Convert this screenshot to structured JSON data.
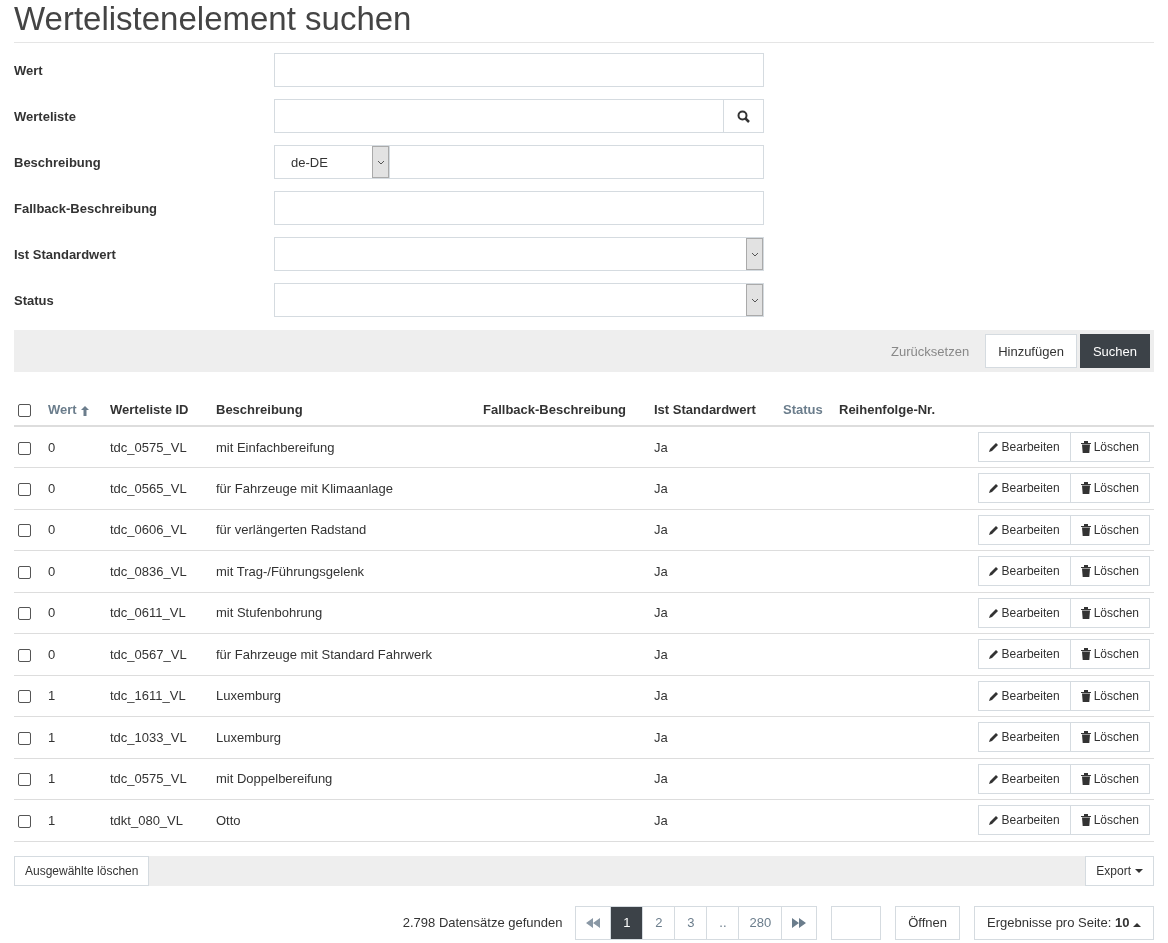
{
  "title": "Wertelistenelement suchen",
  "form": [
    {
      "label": "Wert",
      "kind": "text"
    },
    {
      "label": "Werteliste",
      "kind": "lookup"
    },
    {
      "label": "Beschreibung",
      "kind": "localized",
      "value": "de-DE"
    },
    {
      "label": "Fallback-Beschreibung",
      "kind": "text"
    },
    {
      "label": "Ist Standardwert",
      "kind": "select"
    },
    {
      "label": "Status",
      "kind": "select"
    }
  ],
  "form_actions": [
    {
      "label": "Zurücksetzen",
      "kind": "link"
    },
    {
      "label": "Hinzufügen",
      "kind": "default"
    },
    {
      "label": "Suchen",
      "kind": "primary"
    }
  ],
  "table": {
    "select_all": {
      "checked": false
    },
    "columns": [
      {
        "label": "Wert",
        "sortable": true,
        "sorted": true
      },
      {
        "label": "Werteliste ID",
        "sortable": false,
        "sorted": false
      },
      {
        "label": "Beschreibung",
        "sortable": false,
        "sorted": false
      },
      {
        "label": "Fallback-Beschreibung",
        "sortable": false,
        "sorted": false
      },
      {
        "label": "Ist Standardwert",
        "sortable": false,
        "sorted": false
      },
      {
        "label": "Status",
        "sortable": true,
        "sorted": false
      },
      {
        "label": "Reihenfolge-Nr.",
        "sortable": false,
        "sorted": false
      }
    ],
    "rows": [
      {
        "checked": false,
        "cells": [
          "0",
          "tdc_0575_VL",
          "mit Einfachbereifung",
          "",
          "Ja",
          "",
          ""
        ],
        "actions": [
          "Bearbeiten",
          "Löschen"
        ]
      },
      {
        "checked": false,
        "cells": [
          "0",
          "tdc_0565_VL",
          "für Fahrzeuge mit Klimaanlage",
          "",
          "Ja",
          "",
          ""
        ],
        "actions": [
          "Bearbeiten",
          "Löschen"
        ]
      },
      {
        "checked": false,
        "cells": [
          "0",
          "tdc_0606_VL",
          "für verlängerten Radstand",
          "",
          "Ja",
          "",
          ""
        ],
        "actions": [
          "Bearbeiten",
          "Löschen"
        ]
      },
      {
        "checked": false,
        "cells": [
          "0",
          "tdc_0836_VL",
          "mit Trag-/Führungsgelenk",
          "",
          "Ja",
          "",
          ""
        ],
        "actions": [
          "Bearbeiten",
          "Löschen"
        ]
      },
      {
        "checked": false,
        "cells": [
          "0",
          "tdc_0611_VL",
          "mit Stufenbohrung",
          "",
          "Ja",
          "",
          ""
        ],
        "actions": [
          "Bearbeiten",
          "Löschen"
        ]
      },
      {
        "checked": false,
        "cells": [
          "0",
          "tdc_0567_VL",
          "für Fahrzeuge mit Standard Fahrwerk",
          "",
          "Ja",
          "",
          ""
        ],
        "actions": [
          "Bearbeiten",
          "Löschen"
        ]
      },
      {
        "checked": false,
        "cells": [
          "1",
          "tdc_1611_VL",
          "Luxemburg",
          "",
          "Ja",
          "",
          ""
        ],
        "actions": [
          "Bearbeiten",
          "Löschen"
        ]
      },
      {
        "checked": false,
        "cells": [
          "1",
          "tdc_1033_VL",
          "Luxemburg",
          "",
          "Ja",
          "",
          ""
        ],
        "actions": [
          "Bearbeiten",
          "Löschen"
        ]
      },
      {
        "checked": false,
        "cells": [
          "1",
          "tdc_0575_VL",
          "mit Doppelbereifung",
          "",
          "Ja",
          "",
          ""
        ],
        "actions": [
          "Bearbeiten",
          "Löschen"
        ]
      },
      {
        "checked": false,
        "cells": [
          "1",
          "tdkt_080_VL",
          "Otto",
          "",
          "Ja",
          "",
          ""
        ],
        "actions": [
          "Bearbeiten",
          "Löschen"
        ]
      }
    ]
  },
  "bulk_actions": {
    "delete": "Ausgewählte löschen",
    "export": "Export"
  },
  "footer": {
    "count": "2.798 Datensätze gefunden",
    "pages": [
      {
        "label": "1",
        "selected": true
      },
      {
        "label": "2",
        "selected": false
      },
      {
        "label": "3",
        "selected": false
      },
      {
        "label": "..",
        "selected": false
      },
      {
        "label": "280",
        "selected": false
      }
    ],
    "open": "Öffnen",
    "per_page_label": "Ergebnisse pro Seite:",
    "per_page": "10"
  }
}
